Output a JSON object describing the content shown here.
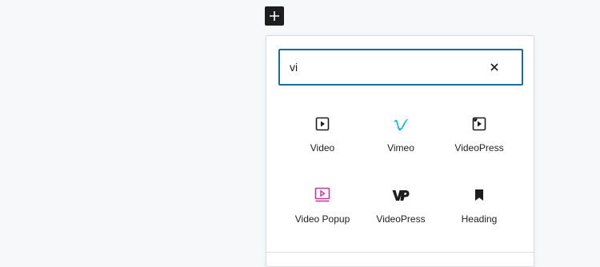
{
  "toolbar": {
    "add_block_icon": "plus-icon"
  },
  "search": {
    "value": "vi",
    "placeholder": "Search",
    "clear_icon": "close-icon"
  },
  "blocks": [
    {
      "label": "Video",
      "icon": "video-icon"
    },
    {
      "label": "Vimeo",
      "icon": "vimeo-icon",
      "color": "#1ab7ea"
    },
    {
      "label": "VideoPress",
      "icon": "videopress-icon"
    },
    {
      "label": "Video Popup",
      "icon": "video-popup-icon",
      "color": "#c0399f"
    },
    {
      "label": "VideoPress",
      "icon": "videopress-logo-icon"
    },
    {
      "label": "Heading",
      "icon": "bookmark-icon"
    }
  ],
  "colors": {
    "focus_border": "#1a6c9f",
    "dark": "#1e1e1e",
    "vimeo": "#1ab7ea",
    "video_popup": "#c0399f"
  }
}
